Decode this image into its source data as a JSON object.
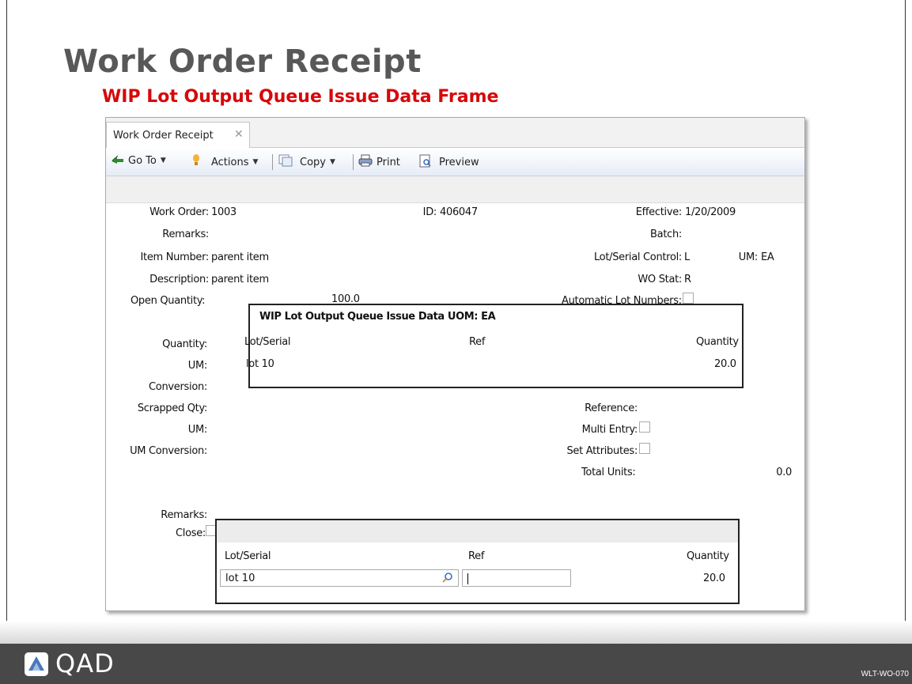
{
  "slide": {
    "title": "Work Order Receipt",
    "subtitle": "WIP Lot Output Queue Issue Data Frame",
    "code": "WLT-WO-070",
    "logo": "QAD"
  },
  "window": {
    "tab_label": "Work Order Receipt",
    "toolbar": {
      "goto": "Go To",
      "actions": "Actions",
      "copy": "Copy",
      "print": "Print",
      "preview": "Preview"
    }
  },
  "form": {
    "work_order_label": "Work Order:",
    "work_order_value": "1003",
    "id_label": "ID:",
    "id_value": "406047",
    "effective_label": "Effective:",
    "effective_value": "1/20/2009",
    "remarks_label": "Remarks:",
    "batch_label": "Batch:",
    "item_number_label": "Item Number:",
    "item_number_value": "parent item",
    "lot_serial_control_label": "Lot/Serial Control:",
    "lot_serial_control_value": "L",
    "um_label": "UM:",
    "um_value": "EA",
    "description_label": "Description:",
    "description_value": "parent item",
    "wo_stat_label": "WO Stat:",
    "wo_stat_value": "R",
    "open_quantity_label": "Open Quantity:",
    "open_quantity_value": "100.0",
    "auto_lot_label": "Automatic Lot Numbers:",
    "quantity_label": "Quantity:",
    "um2_label": "UM:",
    "conversion_label": "Conversion:",
    "scrapped_qty_label": "Scrapped Qty:",
    "reference_label": "Reference:",
    "um3_label": "UM:",
    "multi_entry_label": "Multi Entry:",
    "um_conversion_label": "UM Conversion:",
    "set_attributes_label": "Set Attributes:",
    "total_units_label": "Total Units:",
    "total_units_value": "0.0",
    "remarks2_label": "Remarks:",
    "close_label": "Close:"
  },
  "popup": {
    "title": "WIP Lot Output Queue Issue Data UOM: EA",
    "columns": [
      "Lot/Serial",
      "Ref",
      "Quantity"
    ],
    "rows": [
      {
        "lot": "lot 10",
        "ref": "",
        "qty": "20.0"
      }
    ]
  },
  "grid": {
    "columns": [
      "Lot/Serial",
      "Ref",
      "Quantity"
    ],
    "row": {
      "lot": "lot 10",
      "ref": "",
      "qty": "20.0"
    }
  }
}
